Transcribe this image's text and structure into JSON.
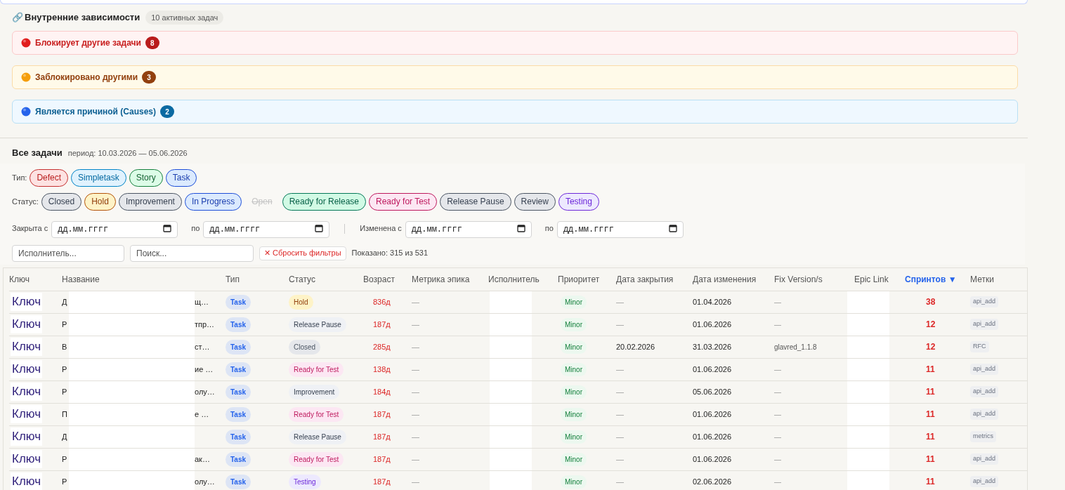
{
  "dependencies": {
    "icon": "🔗",
    "title": "Внутренние зависимости",
    "count": "10 активных задач",
    "groups": [
      {
        "kind": "danger",
        "label": "Блокирует другие задачи",
        "count": "8"
      },
      {
        "kind": "warning",
        "label": "Заблокировано другими",
        "count": "3"
      },
      {
        "kind": "info",
        "label": "Является причиной (Causes)",
        "count": "2"
      }
    ]
  },
  "all_tasks": {
    "title": "Все задачи",
    "period": "период: 10.03.2026 — 05.06.2026"
  },
  "filters": {
    "type_label": "Тип:",
    "types": [
      {
        "label": "Defect",
        "kind": "red",
        "selected": true
      },
      {
        "label": "Simpletask",
        "kind": "sky",
        "selected": true
      },
      {
        "label": "Story",
        "kind": "green",
        "selected": true
      },
      {
        "label": "Task",
        "kind": "blue",
        "selected": true
      }
    ],
    "status_label": "Статус:",
    "statuses": [
      {
        "label": "Closed",
        "kind": "gray",
        "selected": true
      },
      {
        "label": "Hold",
        "kind": "yellow",
        "selected": true
      },
      {
        "label": "Improvement",
        "kind": "gray",
        "selected": true
      },
      {
        "label": "In Progress",
        "kind": "blue",
        "selected": true
      },
      {
        "label": "Open",
        "selected": false
      },
      {
        "label": "Ready for Release",
        "kind": "teal",
        "selected": true
      },
      {
        "label": "Ready for Test",
        "kind": "pink",
        "selected": true
      },
      {
        "label": "Release Pause",
        "kind": "gray",
        "selected": true
      },
      {
        "label": "Review",
        "kind": "gray",
        "selected": true
      },
      {
        "label": "Testing",
        "kind": "purple",
        "selected": true
      }
    ],
    "dates": [
      {
        "label": "Закрыта с",
        "placeholder": "дд.мм.гггг"
      },
      {
        "label": "по",
        "placeholder": "дд.мм.гггг"
      },
      {
        "label": "Изменена с",
        "placeholder": "дд.мм.гггг"
      },
      {
        "label": "по",
        "placeholder": "дд.мм.гггг"
      }
    ],
    "assignee": {
      "placeholder": "Исполнитель..."
    },
    "search": {
      "placeholder": "Поиск..."
    },
    "reset": "✕ Сбросить фильтры",
    "shown": "Показано: 315 из 531"
  },
  "table": {
    "columns": [
      {
        "label": "Ключ",
        "sorted": false
      },
      {
        "label": "Название",
        "sorted": false
      },
      {
        "label": "Тип",
        "sorted": false
      },
      {
        "label": "Статус",
        "sorted": false
      },
      {
        "label": "Возраст",
        "sorted": false
      },
      {
        "label": "Метрика эпика",
        "sorted": false
      },
      {
        "label": "Исполнитель",
        "sorted": false
      },
      {
        "label": "Приоритет",
        "sorted": false
      },
      {
        "label": "Дата закрытия",
        "sorted": false
      },
      {
        "label": "Дата изменения",
        "sorted": false
      },
      {
        "label": "Fix Version/s",
        "sorted": false
      },
      {
        "label": "Epic Link",
        "sorted": false
      },
      {
        "label": "Спринтов ▼",
        "sorted": true
      },
      {
        "label": "Метки",
        "sorted": false
      }
    ],
    "rows": [
      {
        "key": "Ключ",
        "name_start": "Д",
        "name_end": "щ…",
        "type": "Task",
        "status": {
          "text": "Hold",
          "kind": "yellow"
        },
        "age": "836д",
        "epic_metric": "—",
        "priority": "Minor",
        "closed": "—",
        "changed": "01.04.2026",
        "fix_version": "—",
        "sprints": "38",
        "label": "api_add"
      },
      {
        "key": "Ключ",
        "name_start": "Р",
        "name_end": "тпр…",
        "type": "Task",
        "status": {
          "text": "Release Pause",
          "kind": "slate"
        },
        "age": "187д",
        "epic_metric": "—",
        "priority": "Minor",
        "closed": "—",
        "changed": "01.06.2026",
        "fix_version": "—",
        "sprints": "12",
        "label": "api_add"
      },
      {
        "key": "Ключ",
        "name_start": "В",
        "name_end": "ст…",
        "type": "Task",
        "status": {
          "text": "Closed",
          "kind": "gray"
        },
        "age": "285д",
        "epic_metric": "—",
        "priority": "Minor",
        "closed": "20.02.2026",
        "changed": "31.03.2026",
        "fix_version": "glavred_1.1.8",
        "sprints": "12",
        "label": "RFC"
      },
      {
        "key": "Ключ",
        "name_start": "Р",
        "name_end": "ие …",
        "type": "Task",
        "status": {
          "text": "Ready for Test",
          "kind": "pink"
        },
        "age": "138д",
        "epic_metric": "—",
        "priority": "Minor",
        "closed": "—",
        "changed": "01.06.2026",
        "fix_version": "—",
        "sprints": "11",
        "label": "api_add"
      },
      {
        "key": "Ключ",
        "name_start": "Р",
        "name_end": "олу…",
        "type": "Task",
        "status": {
          "text": "Improvement",
          "kind": "slate"
        },
        "age": "184д",
        "epic_metric": "—",
        "priority": "Minor",
        "closed": "—",
        "changed": "05.06.2026",
        "fix_version": "—",
        "sprints": "11",
        "label": "api_add"
      },
      {
        "key": "Ключ",
        "name_start": "П",
        "name_end": "е …",
        "type": "Task",
        "status": {
          "text": "Ready for Test",
          "kind": "pink"
        },
        "age": "187д",
        "epic_metric": "—",
        "priority": "Minor",
        "closed": "—",
        "changed": "01.06.2026",
        "fix_version": "—",
        "sprints": "11",
        "label": "api_add"
      },
      {
        "key": "Ключ",
        "name_start": "Д",
        "type": "Task",
        "status": {
          "text": "Release Pause",
          "kind": "slate"
        },
        "age": "187д",
        "epic_metric": "—",
        "priority": "Minor",
        "closed": "—",
        "changed": "01.06.2026",
        "fix_version": "—",
        "sprints": "11",
        "label": "metrics"
      },
      {
        "key": "Ключ",
        "name_start": "Р",
        "name_end": "ак…",
        "type": "Task",
        "status": {
          "text": "Ready for Test",
          "kind": "pink"
        },
        "age": "187д",
        "epic_metric": "—",
        "priority": "Minor",
        "closed": "—",
        "changed": "01.06.2026",
        "fix_version": "—",
        "sprints": "11",
        "label": "api_add"
      },
      {
        "key": "Ключ",
        "name_start": "Р",
        "name_end": "олу…",
        "type": "Task",
        "status": {
          "text": "Testing",
          "kind": "purple"
        },
        "age": "187д",
        "epic_metric": "—",
        "priority": "Minor",
        "closed": "—",
        "changed": "02.06.2026",
        "fix_version": "—",
        "sprints": "11",
        "label": "api_add"
      }
    ]
  }
}
